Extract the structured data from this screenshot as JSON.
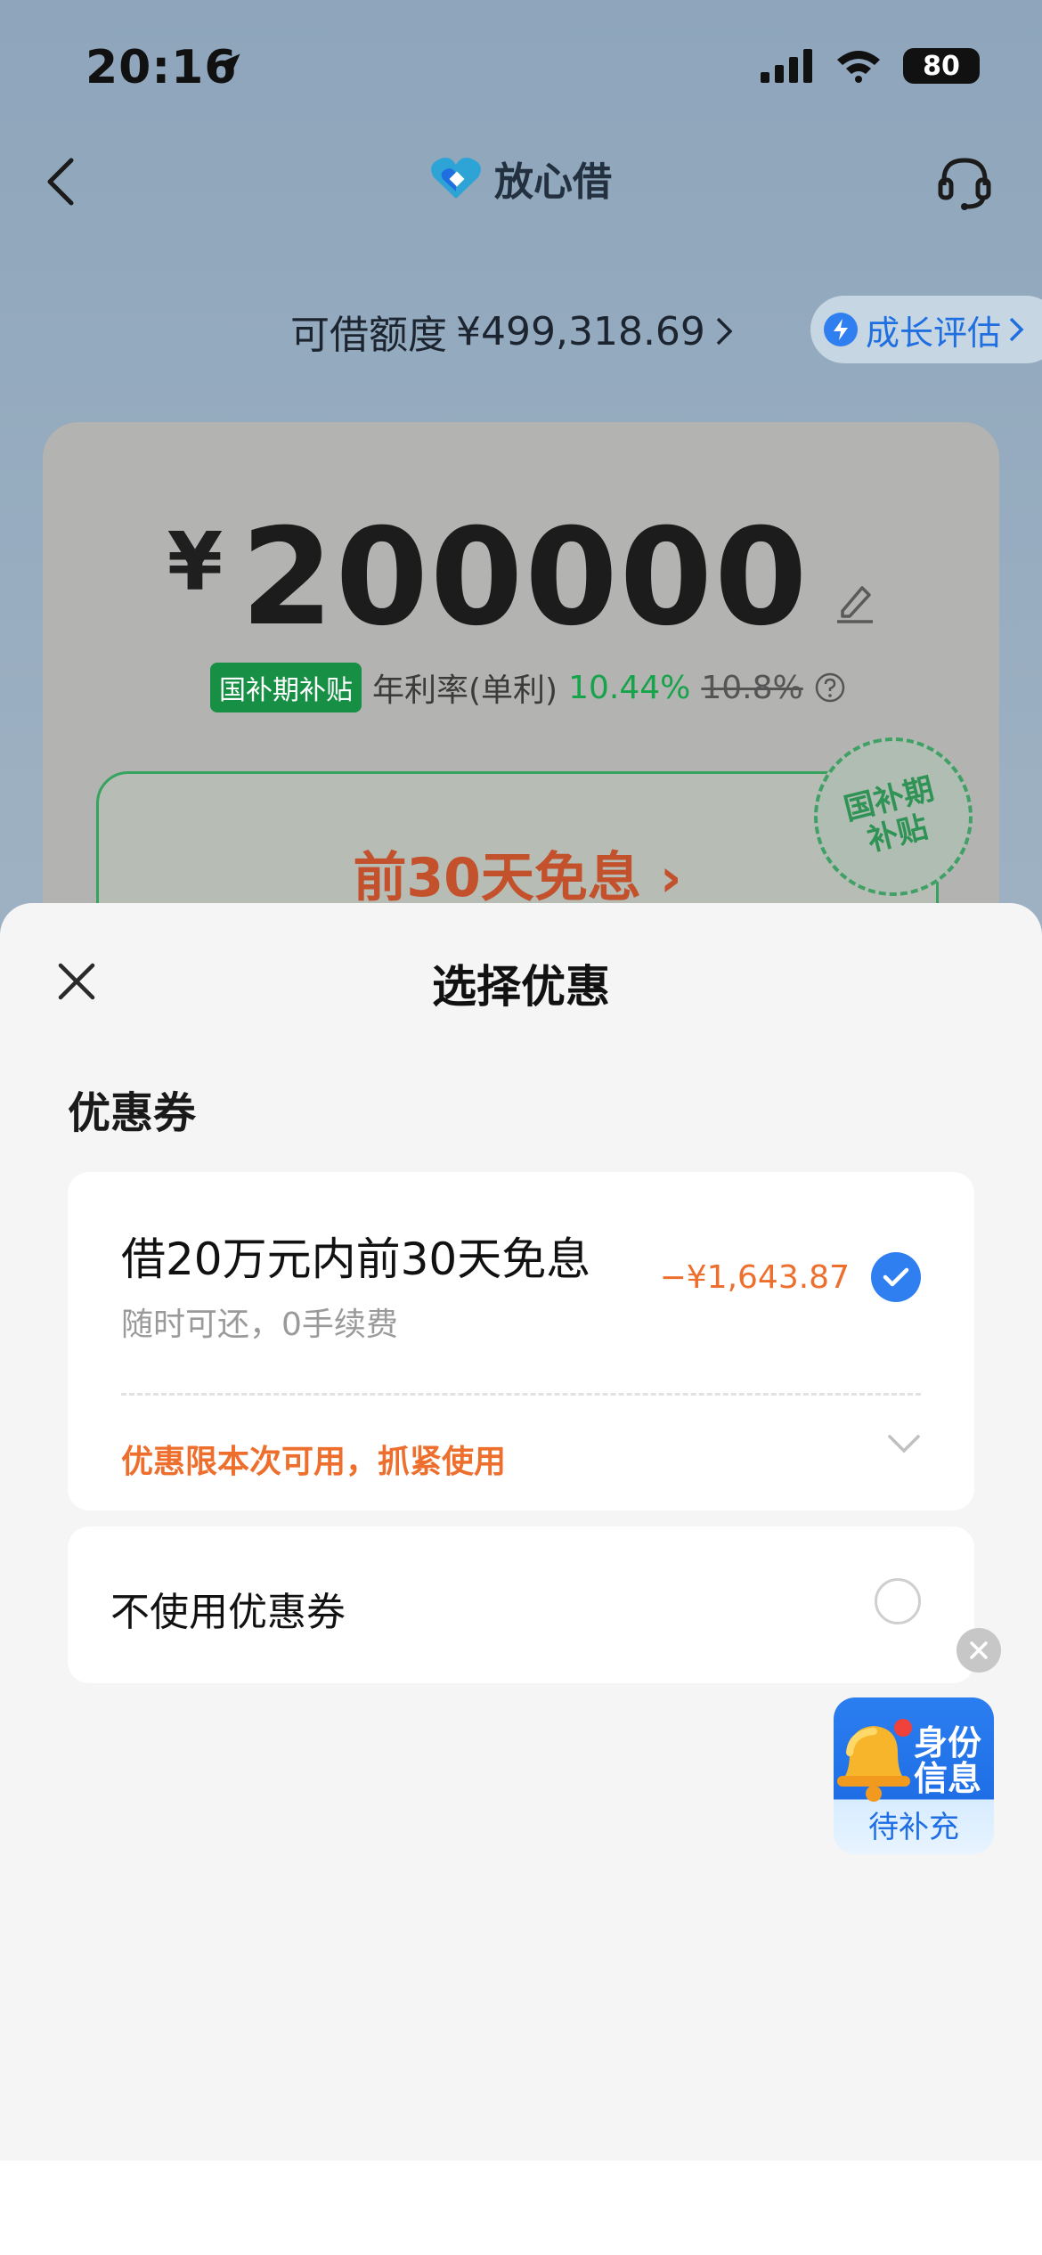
{
  "status_bar": {
    "time": "20:16",
    "battery": "80"
  },
  "nav": {
    "title": "放心借"
  },
  "credit": {
    "label": "可借额度",
    "amount": "¥499,318.69",
    "growth_label": "成长评估"
  },
  "loan": {
    "currency": "¥",
    "amount": "200000",
    "subsidy_tag": "国补期补贴",
    "rate_label": "年利率(单利)",
    "rate_new": "10.44%",
    "rate_old": "10.8%",
    "free_interest": "前30天免息",
    "stamp_text": "国补期补贴"
  },
  "sheet": {
    "title": "选择优惠",
    "section_title": "优惠券",
    "coupon": {
      "title": "借20万元内前30天免息",
      "subtitle": "随时可还，0手续费",
      "discount": "−¥1,643.87",
      "note": "优惠限本次可用，抓紧使用",
      "selected": true
    },
    "no_coupon_label": "不使用优惠券"
  },
  "floating_widget": {
    "line1": "身份",
    "line2": "信息",
    "action": "待补充"
  },
  "colors": {
    "accent_blue": "#2f7ff0",
    "accent_orange": "#ee6f2d",
    "accent_green": "#16a34a"
  }
}
